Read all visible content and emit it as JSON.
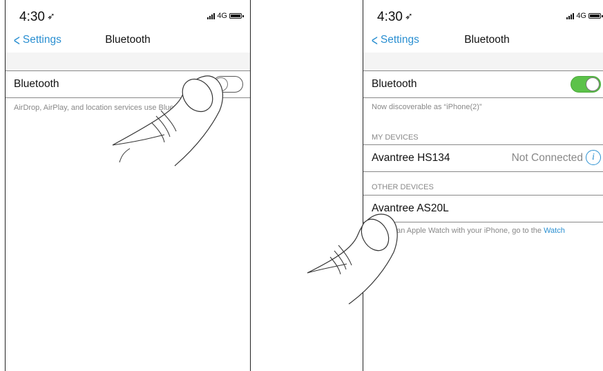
{
  "left": {
    "time": "4:30",
    "network": "4G",
    "back_label": "Settings",
    "title": "Bluetooth",
    "bt_label": "Bluetooth",
    "bt_on": false,
    "footer": "AirDrop, AirPlay, and location services use Bluetooth."
  },
  "right": {
    "time": "4:30",
    "network": "4G",
    "back_label": "Settings",
    "title": "Bluetooth",
    "bt_label": "Bluetooth",
    "bt_on": true,
    "discoverable": "Now discoverable as “iPhone(2)”",
    "my_devices_header": "MY DEVICES",
    "my_devices": [
      {
        "name": "Avantree HS134",
        "status": "Not Connected"
      }
    ],
    "other_devices_header": "OTHER DEVICES",
    "other_devices": [
      {
        "name": "Avantree AS20L"
      }
    ],
    "watch_note_prefix": "To pair an Apple Watch with your iPhone, go to the ",
    "watch_link": "Watch"
  },
  "colors": {
    "accent": "#2a8fd1",
    "toggle_on": "#5cc24a",
    "secondary_text": "#888888"
  },
  "icons": [
    "location-arrow-icon",
    "signal-icon",
    "battery-icon",
    "chevron-left-icon",
    "info-icon",
    "hand-pointer-icon"
  ]
}
